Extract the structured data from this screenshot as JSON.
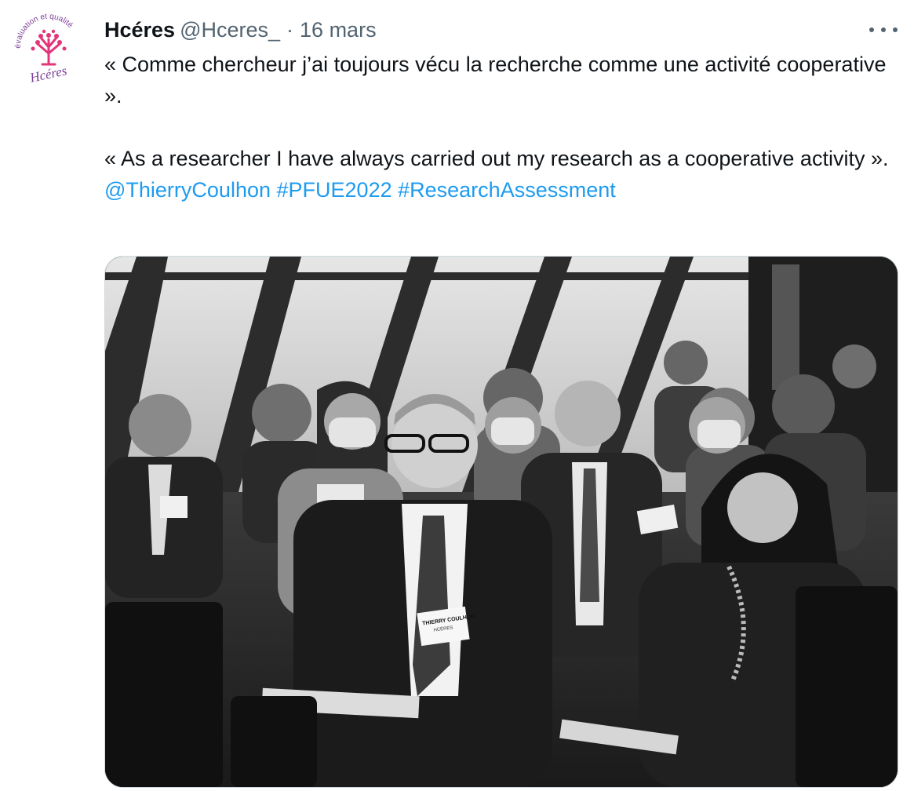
{
  "tweet": {
    "author": {
      "display_name": "Hcéres",
      "handle": "@Hceres_",
      "separator": "·",
      "avatar_text_arc": "évaluation et qualité",
      "avatar_logo_text": "Hcéres"
    },
    "date": "16 mars",
    "text_fr": "« Comme chercheur j’ai toujours vécu la recherche comme une activité cooperative ».",
    "text_en": "« As a researcher I have always carried out my research as a cooperative activity ».",
    "mentions": [
      "@ThierryCoulhon"
    ],
    "hashtags": [
      "#PFUE2022",
      "#ResearchAssessment"
    ],
    "media": {
      "badge_line1": "THIERRY COULHON",
      "badge_line2": "HCÉRES"
    },
    "more_icon": "more-horizontal-icon",
    "colors": {
      "link": "#1d9bf0",
      "secondary": "#536471",
      "text": "#0f1419",
      "avatar_pink": "#e2357a",
      "avatar_purple": "#7b3f98"
    }
  }
}
